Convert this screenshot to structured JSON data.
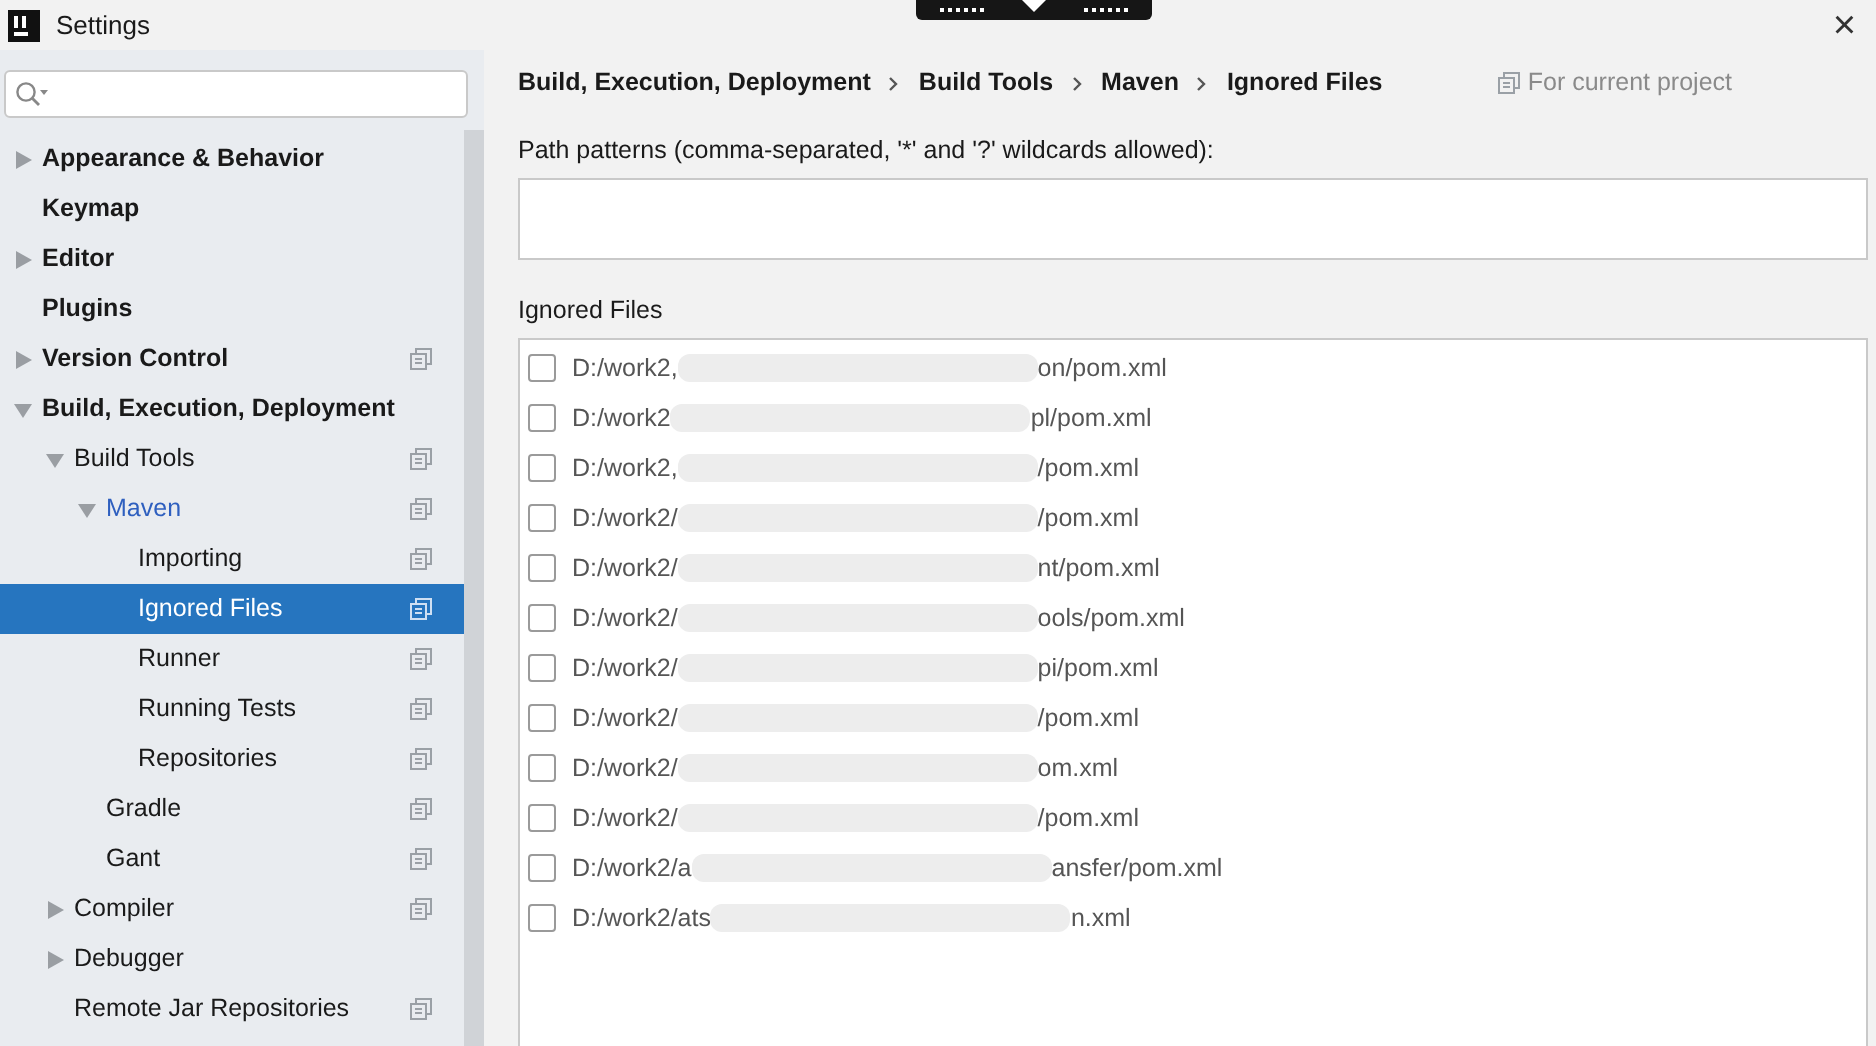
{
  "window": {
    "title": "Settings",
    "close": "×"
  },
  "sidebar": {
    "items": [
      {
        "label": "Appearance & Behavior",
        "expanded": false,
        "selected": false,
        "modified": false,
        "project": false
      },
      {
        "label": "Keymap",
        "selected": false,
        "modified": false,
        "project": false
      },
      {
        "label": "Editor",
        "expanded": false,
        "selected": false,
        "modified": false,
        "project": false
      },
      {
        "label": "Plugins",
        "selected": false,
        "modified": false,
        "project": false
      },
      {
        "label": "Version Control",
        "expanded": false,
        "selected": false,
        "modified": false,
        "project": true
      },
      {
        "label": "Build, Execution, Deployment",
        "expanded": true,
        "selected": false,
        "modified": false,
        "project": false,
        "children": [
          {
            "label": "Build Tools",
            "expanded": true,
            "selected": false,
            "modified": false,
            "project": true,
            "children": [
              {
                "label": "Maven",
                "expanded": true,
                "selected": false,
                "modified": true,
                "project": true,
                "children": [
                  {
                    "label": "Importing",
                    "selected": false,
                    "modified": false,
                    "project": true
                  },
                  {
                    "label": "Ignored Files",
                    "selected": true,
                    "modified": false,
                    "project": true
                  },
                  {
                    "label": "Runner",
                    "selected": false,
                    "modified": false,
                    "project": true
                  },
                  {
                    "label": "Running Tests",
                    "selected": false,
                    "modified": false,
                    "project": true
                  },
                  {
                    "label": "Repositories",
                    "selected": false,
                    "modified": false,
                    "project": true
                  }
                ]
              },
              {
                "label": "Gradle",
                "selected": false,
                "modified": false,
                "project": true
              },
              {
                "label": "Gant",
                "selected": false,
                "modified": false,
                "project": true
              }
            ]
          },
          {
            "label": "Compiler",
            "expanded": false,
            "selected": false,
            "modified": false,
            "project": true
          },
          {
            "label": "Debugger",
            "expanded": false,
            "selected": false,
            "modified": false,
            "project": false
          },
          {
            "label": "Remote Jar Repositories",
            "selected": false,
            "modified": false,
            "project": true
          }
        ]
      }
    ]
  },
  "breadcrumb": [
    "Build, Execution, Deployment",
    "Build Tools",
    "Maven",
    "Ignored Files"
  ],
  "scope_note": "For current project",
  "path_patterns": {
    "label": "Path patterns (comma-separated, '*' and '?' wildcards allowed):"
  },
  "ignored_files": {
    "label": "Ignored Files",
    "rows": [
      {
        "checked": false,
        "start": "D:/work2,",
        "end": "on/pom.xml"
      },
      {
        "checked": false,
        "start": "D:/work2",
        "end": "pl/pom.xml"
      },
      {
        "checked": false,
        "start": "D:/work2,",
        "end": "/pom.xml"
      },
      {
        "checked": false,
        "start": "D:/work2/",
        "end": "/pom.xml"
      },
      {
        "checked": false,
        "start": "D:/work2/",
        "end": "nt/pom.xml"
      },
      {
        "checked": false,
        "start": "D:/work2/",
        "end": "ools/pom.xml"
      },
      {
        "checked": false,
        "start": "D:/work2/",
        "end": "pi/pom.xml"
      },
      {
        "checked": false,
        "start": "D:/work2/",
        "end": "/pom.xml"
      },
      {
        "checked": false,
        "start": "D:/work2/",
        "end": "om.xml"
      },
      {
        "checked": false,
        "start": "D:/work2/",
        "end": "/pom.xml"
      },
      {
        "checked": false,
        "start": "D:/work2/a",
        "end": "ansfer/pom.xml"
      },
      {
        "checked": false,
        "start": "D:/work2/ats",
        "end": "n.xml"
      }
    ]
  }
}
